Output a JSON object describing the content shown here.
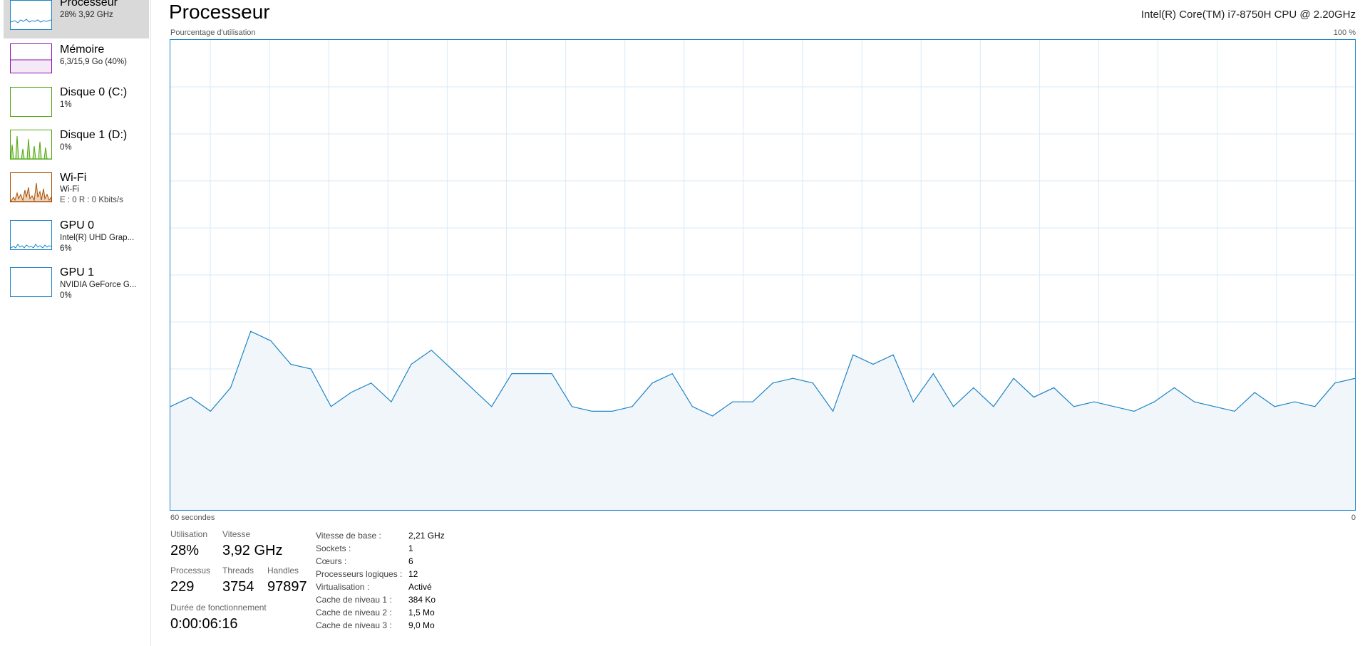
{
  "sidebar": {
    "items": [
      {
        "name": "Processeur",
        "sub1": "28% 3,92 GHz",
        "sub2": "",
        "selected": true,
        "color": "#1c84c6",
        "icon": "cpu-graph-icon"
      },
      {
        "name": "Mémoire",
        "sub1": "6,3/15,9 Go (40%)",
        "sub2": "",
        "selected": false,
        "color": "#8b12ae",
        "icon": "memory-graph-icon"
      },
      {
        "name": "Disque 0 (C:)",
        "sub1": "1%",
        "sub2": "",
        "selected": false,
        "color": "#4da60c",
        "icon": "disk-graph-icon"
      },
      {
        "name": "Disque 1 (D:)",
        "sub1": "0%",
        "sub2": "",
        "selected": false,
        "color": "#4da60c",
        "icon": "disk-graph-icon"
      },
      {
        "name": "Wi-Fi",
        "sub1": "Wi-Fi",
        "sub2": "E : 0 R : 0 Kbits/s",
        "selected": false,
        "color": "#a74f01",
        "icon": "network-graph-icon"
      },
      {
        "name": "GPU 0",
        "sub1": "Intel(R) UHD Grap...",
        "sub2": "6%",
        "selected": false,
        "color": "#1c84c6",
        "icon": "gpu-graph-icon"
      },
      {
        "name": "GPU 1",
        "sub1": "NVIDIA GeForce G...",
        "sub2": "0%",
        "selected": false,
        "color": "#1c84c6",
        "icon": "gpu-graph-icon"
      }
    ]
  },
  "main": {
    "title": "Processeur",
    "cpu_model": "Intel(R) Core(TM) i7-8750H CPU @ 2.20GHz",
    "chart_label": "Pourcentage d'utilisation",
    "chart_max": "100 %",
    "axis_left": "60 secondes",
    "axis_right": "0"
  },
  "chart_data": {
    "type": "area",
    "color": "#1c84c6",
    "fill": "#f1f6fa",
    "grid": true,
    "ylim": [
      0,
      100
    ],
    "xlim": [
      60,
      0
    ],
    "values": [
      22,
      24,
      21,
      26,
      38,
      36,
      31,
      30,
      22,
      25,
      27,
      23,
      31,
      34,
      30,
      26,
      22,
      29,
      29,
      29,
      22,
      21,
      21,
      22,
      27,
      29,
      22,
      20,
      23,
      23,
      27,
      28,
      27,
      21,
      33,
      31,
      33,
      23,
      29,
      22,
      26,
      22,
      28,
      24,
      26,
      22,
      23,
      22,
      21,
      23,
      26,
      23,
      22,
      21,
      25,
      22,
      23,
      22,
      27,
      28
    ],
    "ticks": {
      "label_left": "60 secondes",
      "label_right": "0",
      "label_top": "100 %"
    }
  },
  "stats": {
    "utilisation_label": "Utilisation",
    "utilisation_value": "28%",
    "vitesse_label": "Vitesse",
    "vitesse_value": "3,92 GHz",
    "processus_label": "Processus",
    "processus_value": "229",
    "threads_label": "Threads",
    "threads_value": "3754",
    "handles_label": "Handles",
    "handles_value": "97897",
    "uptime_label": "Durée de fonctionnement",
    "uptime_value": "0:00:06:16"
  },
  "specs": [
    {
      "label": "Vitesse de base :",
      "value": "2,21 GHz"
    },
    {
      "label": "Sockets :",
      "value": "1"
    },
    {
      "label": "Cœurs :",
      "value": "6"
    },
    {
      "label": "Processeurs logiques :",
      "value": "12"
    },
    {
      "label": "Virtualisation :",
      "value": "Activé"
    },
    {
      "label": "Cache de niveau 1 :",
      "value": "384 Ko"
    },
    {
      "label": "Cache de niveau 2 :",
      "value": "1,5 Mo"
    },
    {
      "label": "Cache de niveau 3 :",
      "value": "9,0 Mo"
    }
  ]
}
